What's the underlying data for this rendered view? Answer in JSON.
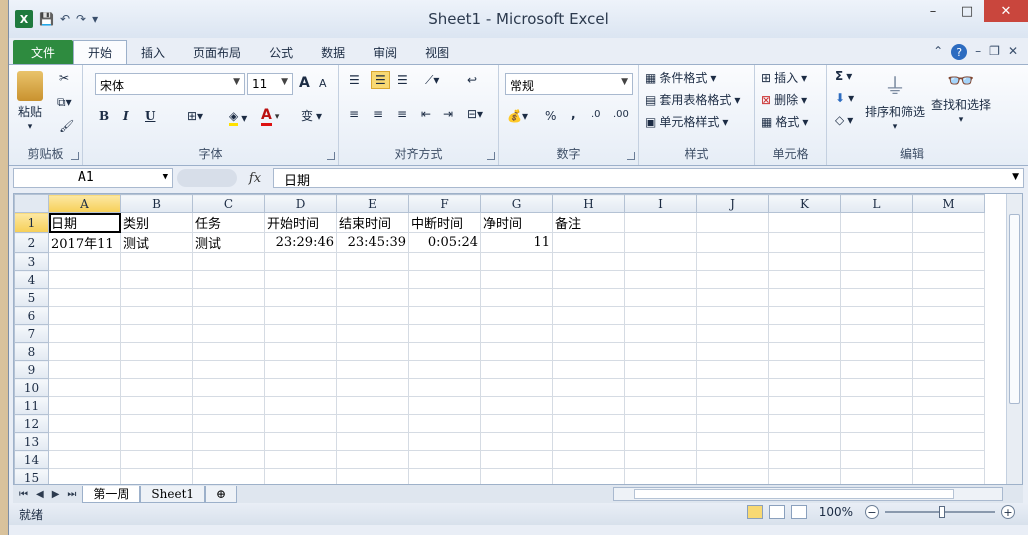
{
  "window": {
    "title": "Sheet1 - Microsoft Excel",
    "controls": {
      "minimize": "–",
      "maximize": "□",
      "close": "✕"
    }
  },
  "tabs": [
    "文件",
    "开始",
    "插入",
    "页面布局",
    "公式",
    "数据",
    "审阅",
    "视图"
  ],
  "ribbon": {
    "clipboard": {
      "label": "剪贴板",
      "paste": "粘贴"
    },
    "font": {
      "label": "字体",
      "name": "宋体",
      "size": "11",
      "bold": "B",
      "italic": "I",
      "underline": "U",
      "grow": "A",
      "shrink": "A",
      "color_a": "A",
      "phonetic": "变"
    },
    "alignment": {
      "label": "对齐方式"
    },
    "number": {
      "label": "数字",
      "format": "常规",
      "percent": "%",
      "comma": ",",
      "inc": ".0",
      "dec": ".00"
    },
    "styles": {
      "label": "样式",
      "conditional": "条件格式",
      "table": "套用表格格式",
      "cell": "单元格样式"
    },
    "cells": {
      "label": "单元格",
      "insert": "插入",
      "delete": "删除",
      "format": "格式"
    },
    "editing": {
      "label": "编辑",
      "sort": "排序和筛选",
      "find": "查找和选择",
      "sum": "Σ"
    }
  },
  "formula_bar": {
    "name_box": "A1",
    "fx": "fx",
    "content": "日期"
  },
  "columns": [
    "A",
    "B",
    "C",
    "D",
    "E",
    "F",
    "G",
    "H",
    "I",
    "J",
    "K",
    "L",
    "M"
  ],
  "rows": [
    [
      "日期",
      "类别",
      "任务",
      "开始时间",
      "结束时间",
      "中断时间",
      "净时间",
      "备注",
      "",
      "",
      "",
      "",
      ""
    ],
    [
      "2017年11",
      "测试",
      "测试",
      "23:29:46",
      "23:45:39",
      "0:05:24",
      "11",
      "",
      "",
      "",
      "",
      "",
      ""
    ],
    [
      "",
      "",
      "",
      "",
      "",
      "",
      "",
      "",
      "",
      "",
      "",
      "",
      ""
    ],
    [
      "",
      "",
      "",
      "",
      "",
      "",
      "",
      "",
      "",
      "",
      "",
      "",
      ""
    ],
    [
      "",
      "",
      "",
      "",
      "",
      "",
      "",
      "",
      "",
      "",
      "",
      "",
      ""
    ],
    [
      "",
      "",
      "",
      "",
      "",
      "",
      "",
      "",
      "",
      "",
      "",
      "",
      ""
    ],
    [
      "",
      "",
      "",
      "",
      "",
      "",
      "",
      "",
      "",
      "",
      "",
      "",
      ""
    ],
    [
      "",
      "",
      "",
      "",
      "",
      "",
      "",
      "",
      "",
      "",
      "",
      "",
      ""
    ],
    [
      "",
      "",
      "",
      "",
      "",
      "",
      "",
      "",
      "",
      "",
      "",
      "",
      ""
    ],
    [
      "",
      "",
      "",
      "",
      "",
      "",
      "",
      "",
      "",
      "",
      "",
      "",
      ""
    ],
    [
      "",
      "",
      "",
      "",
      "",
      "",
      "",
      "",
      "",
      "",
      "",
      "",
      ""
    ],
    [
      "",
      "",
      "",
      "",
      "",
      "",
      "",
      "",
      "",
      "",
      "",
      "",
      ""
    ],
    [
      "",
      "",
      "",
      "",
      "",
      "",
      "",
      "",
      "",
      "",
      "",
      "",
      ""
    ],
    [
      "",
      "",
      "",
      "",
      "",
      "",
      "",
      "",
      "",
      "",
      "",
      "",
      ""
    ],
    [
      "",
      "",
      "",
      "",
      "",
      "",
      "",
      "",
      "",
      "",
      "",
      "",
      ""
    ]
  ],
  "numeric_cells": [
    [
      1,
      3
    ],
    [
      1,
      4
    ],
    [
      1,
      5
    ],
    [
      1,
      6
    ]
  ],
  "sheets": [
    "第一周",
    "Sheet1"
  ],
  "status": {
    "ready": "就绪",
    "zoom": "100%"
  },
  "colors": {
    "file_tab": "#2e8b3f",
    "selected_header": "#f6cf57",
    "close": "#c9463d"
  }
}
